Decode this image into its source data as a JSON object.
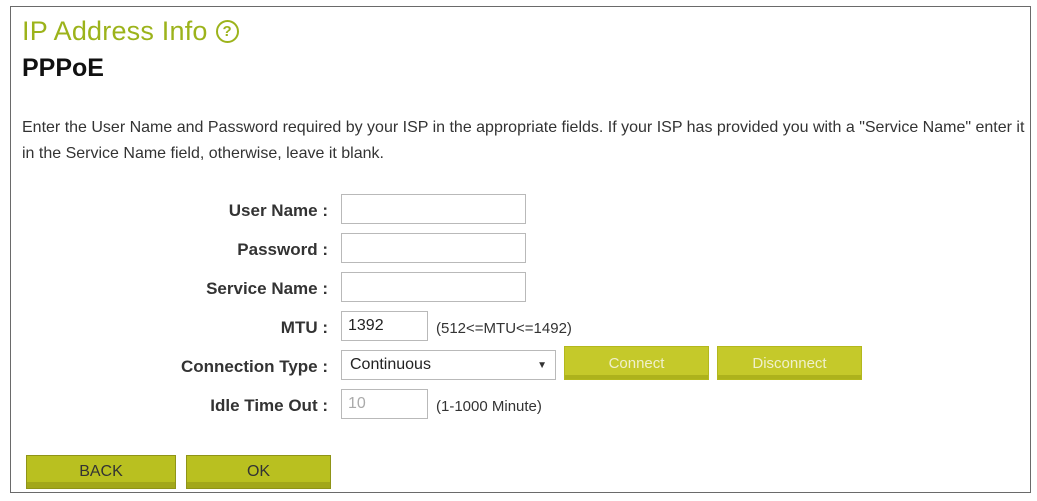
{
  "header": {
    "title": "IP Address Info",
    "subtitle": "PPPoE"
  },
  "description": "Enter the User Name and Password required by your ISP in the appropriate fields. If your ISP has provided you with a \"Service Name\" enter it in the Service Name field, otherwise, leave it blank.",
  "form": {
    "user_name": {
      "label": "User Name :",
      "value": ""
    },
    "password": {
      "label": "Password :",
      "value": ""
    },
    "service_name": {
      "label": "Service Name :",
      "value": ""
    },
    "mtu": {
      "label": "MTU :",
      "value": "1392",
      "hint": "(512<=MTU<=1492)"
    },
    "connection_type": {
      "label": "Connection Type :",
      "selected": "Continuous"
    },
    "idle_timeout": {
      "label": "Idle Time Out :",
      "value": "10",
      "hint": "(1-1000 Minute)"
    }
  },
  "buttons": {
    "connect": "Connect",
    "disconnect": "Disconnect",
    "back": "BACK",
    "ok": "OK"
  },
  "colors": {
    "accent": "#9cb31b",
    "button": "#c5c92a"
  }
}
